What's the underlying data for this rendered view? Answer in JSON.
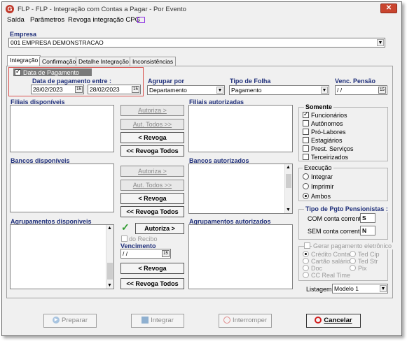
{
  "window": {
    "title": "FLP - FLP - Integração com Contas a Pagar - Por Evento",
    "close_glyph": "✕"
  },
  "menu": {
    "saida": "Saída",
    "parametros": "Parâmetros",
    "revoga": "Revoga integração CPG"
  },
  "empresa": {
    "label": "Empresa",
    "value": "001 EMPRESA DEMONSTRACAO"
  },
  "tabs": [
    "Integração",
    "Confirmação",
    "Detalhe Integração",
    "Inconsistências"
  ],
  "filtro": {
    "data_pagamento_label": "Data de Pagamento",
    "data_pagamento_checked": true,
    "data_entre_label": "Data de pagamento entre :",
    "data_inicio": "28/02/2023",
    "data_fim": "28/02/2023",
    "agrupar_label": "Agrupar por",
    "agrupar_value": "Departamento",
    "tipo_folha_label": "Tipo de Folha",
    "tipo_folha_value": "Pagamento",
    "venc_pensao_label": "Venc. Pensão",
    "venc_pensao_value": " / /"
  },
  "filiais": {
    "disponiveis_label": "Filiais disponíveis",
    "autorizadas_label": "Filiais autorizadas",
    "autoriza": "Autoriza >",
    "aut_todos": "Aut. Todos >>",
    "revoga": "< Revoga",
    "revoga_todos": "<< Revoga Todos"
  },
  "bancos": {
    "disponiveis_label": "Bancos disponíveis",
    "autorizados_label": "Bancos autorizados",
    "autoriza": "Autoriza >",
    "aut_todos": "Aut. Todos >>",
    "revoga": "< Revoga",
    "revoga_todos": "<< Revoga Todos"
  },
  "agrupamentos": {
    "disponiveis_label": "Agrupamentos disponíveis",
    "autorizados_label": "Agrupamentos autorizados",
    "autoriza": "Autoriza >",
    "do_recibo": "do Recibo",
    "vencimento_label": "Vencimento",
    "vencimento_value": " / /",
    "revoga": "< Revoga",
    "revoga_todos": "<< Revoga Todos"
  },
  "somente": {
    "title": "Somente",
    "items": [
      {
        "label": "Funcionários",
        "checked": true
      },
      {
        "label": "Autônomos",
        "checked": false
      },
      {
        "label": "Pró-Labores",
        "checked": false
      },
      {
        "label": "Estagiários",
        "checked": false
      },
      {
        "label": "Prest. Serviços",
        "checked": false
      },
      {
        "label": "Terceirizados",
        "checked": false
      }
    ]
  },
  "execucao": {
    "title": "Execução",
    "items": [
      {
        "label": "Integrar",
        "checked": false
      },
      {
        "label": "Imprimir",
        "checked": false
      },
      {
        "label": "Ambos",
        "checked": true
      }
    ]
  },
  "pensionistas": {
    "title": "Tipo de Pgto Pensionistas :",
    "com_label": "COM conta corrente",
    "com_value": "S",
    "sem_label": "SEM conta corrente",
    "sem_value": "N"
  },
  "eletronico": {
    "title": "Gerar pagamento eletrônico",
    "credito_conta": "Crédito Conta",
    "ted_cip": "Ted Cip",
    "cartao_salario": "Cartão salário",
    "ted_str": "Ted Str",
    "doc": "Doc",
    "pix": "Pix",
    "cc_real_time": "CC Real Time"
  },
  "listagem": {
    "label": "Listagem",
    "value": "Modelo 1"
  },
  "bottom": {
    "preparar": "Preparar",
    "integrar": "Integrar",
    "interromper": "Interromper",
    "cancelar": "Cancelar"
  }
}
